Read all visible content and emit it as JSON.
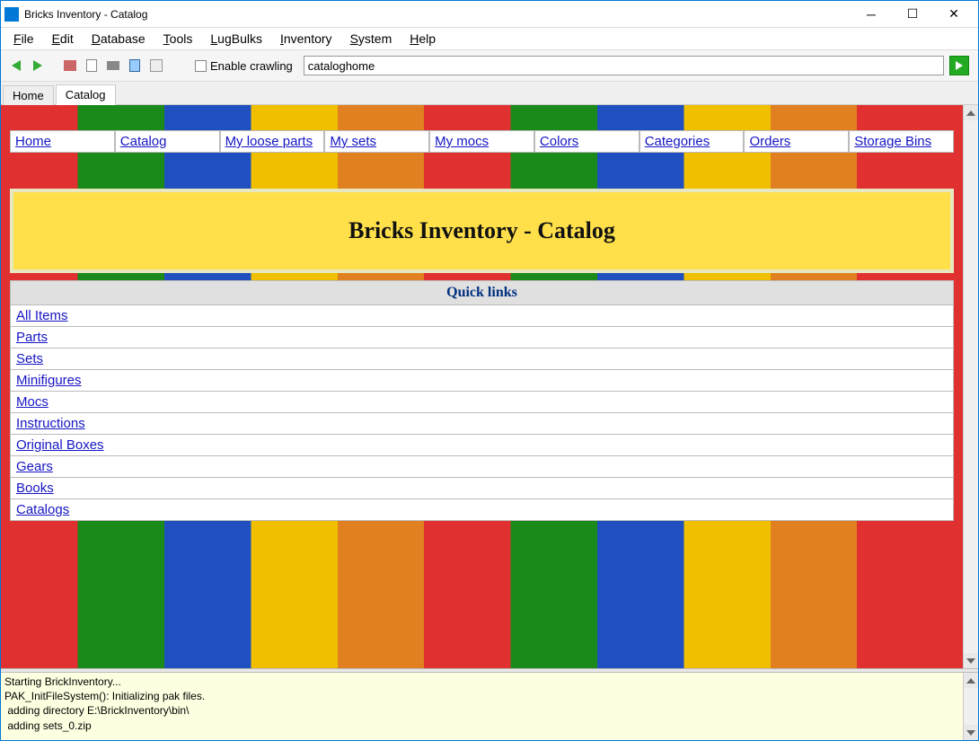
{
  "window": {
    "title": "Bricks Inventory - Catalog"
  },
  "menu": {
    "file": "File",
    "edit": "Edit",
    "database": "Database",
    "tools": "Tools",
    "lugbulks": "LugBulks",
    "inventory": "Inventory",
    "system": "System",
    "help": "Help"
  },
  "toolbar": {
    "crawl_label": "Enable crawling",
    "address_value": "cataloghome"
  },
  "tabs": {
    "home": "Home",
    "catalog": "Catalog"
  },
  "nav": {
    "home": "Home",
    "catalog": "Catalog",
    "loose": "My loose parts",
    "sets": "My sets",
    "mocs": "My mocs",
    "colors": "Colors",
    "categories": "Categories",
    "orders": "Orders",
    "bins": "Storage Bins"
  },
  "banner": {
    "title": "Bricks Inventory - Catalog"
  },
  "quicklinks": {
    "header": "Quick links",
    "items": [
      "All Items",
      "Parts",
      "Sets",
      "Minifigures",
      "Mocs",
      "Instructions",
      "Original Boxes",
      "Gears",
      "Books",
      "Catalogs"
    ]
  },
  "log": {
    "l0": "Starting BrickInventory...",
    "l1": "PAK_InitFileSystem(): Initializing pak files.",
    "l2": " adding directory E:\\BrickInventory\\bin\\",
    "l3": " adding sets_0.zip"
  }
}
